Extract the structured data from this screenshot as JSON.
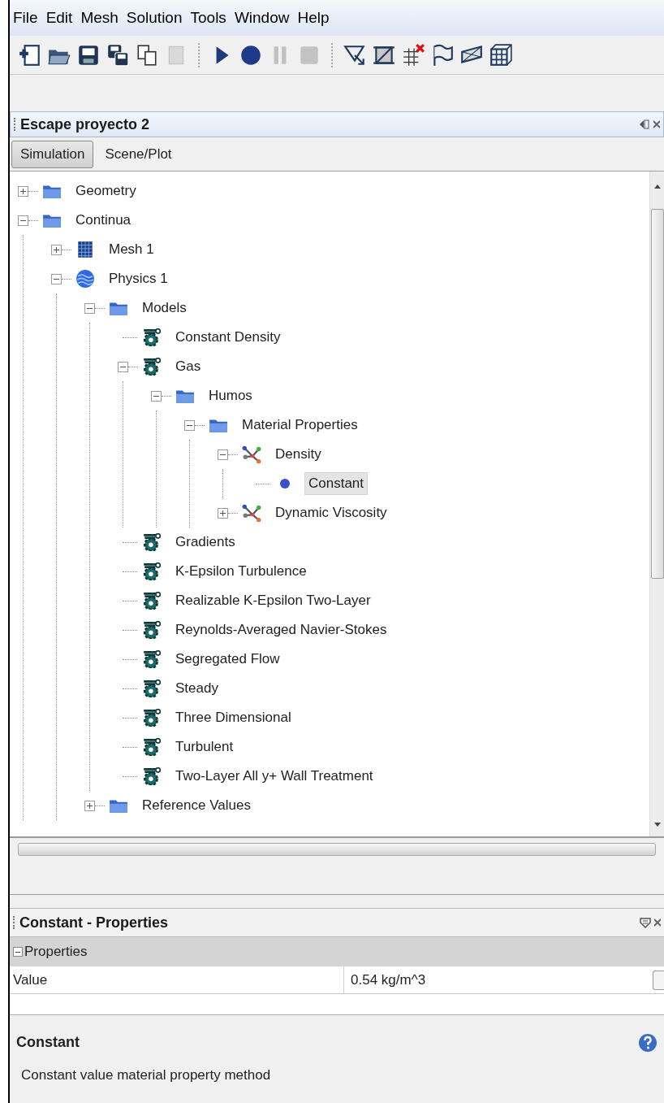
{
  "menu": [
    "File",
    "Edit",
    "Mesh",
    "Solution",
    "Tools",
    "Window",
    "Help"
  ],
  "toolbar": [
    {
      "kind": "new"
    },
    {
      "kind": "open"
    },
    {
      "kind": "save"
    },
    {
      "kind": "saveas"
    },
    {
      "kind": "copy"
    },
    {
      "kind": "blank",
      "disabled": true
    },
    {
      "kind": "sep"
    },
    {
      "kind": "play"
    },
    {
      "kind": "record"
    },
    {
      "kind": "pause",
      "disabled": true
    },
    {
      "kind": "stop",
      "disabled": true
    },
    {
      "kind": "sep"
    },
    {
      "kind": "select"
    },
    {
      "kind": "crop"
    },
    {
      "kind": "gridx"
    },
    {
      "kind": "flag"
    },
    {
      "kind": "plane"
    },
    {
      "kind": "cube"
    }
  ],
  "panel": {
    "title": "Escape proyecto 2"
  },
  "tabs": [
    {
      "label": "Simulation",
      "selected": true
    },
    {
      "label": "Scene/Plot",
      "selected": false
    }
  ],
  "tree": [
    {
      "label": "Geometry",
      "kind": "folder",
      "expanded": false,
      "selected": false
    },
    {
      "label": "Continua",
      "kind": "folder",
      "expanded": true,
      "selected": false,
      "children": [
        {
          "label": "Mesh 1",
          "kind": "mesh",
          "expanded": false,
          "selected": false
        },
        {
          "label": "Physics 1",
          "kind": "physics",
          "expanded": true,
          "selected": false,
          "children": [
            {
              "label": "Models",
              "kind": "folder",
              "expanded": true,
              "selected": false,
              "children": [
                {
                  "label": "Constant Density",
                  "kind": "model",
                  "selected": false
                },
                {
                  "label": "Gas",
                  "kind": "model",
                  "expanded": true,
                  "selected": false,
                  "children": [
                    {
                      "label": "Humos",
                      "kind": "folder",
                      "expanded": true,
                      "selected": false,
                      "children": [
                        {
                          "label": "Material Properties",
                          "kind": "folder",
                          "expanded": true,
                          "selected": false,
                          "children": [
                            {
                              "label": "Density",
                              "kind": "method",
                              "expanded": true,
                              "selected": false,
                              "children": [
                                {
                                  "label": "Constant",
                                  "kind": "value",
                                  "selected": true
                                }
                              ]
                            },
                            {
                              "label": "Dynamic Viscosity",
                              "kind": "method",
                              "expanded": false,
                              "selected": false
                            }
                          ]
                        }
                      ]
                    }
                  ]
                },
                {
                  "label": "Gradients",
                  "kind": "model",
                  "selected": false
                },
                {
                  "label": "K-Epsilon Turbulence",
                  "kind": "model",
                  "selected": false
                },
                {
                  "label": "Realizable K-Epsilon Two-Layer",
                  "kind": "model",
                  "selected": false
                },
                {
                  "label": "Reynolds-Averaged Navier-Stokes",
                  "kind": "model",
                  "selected": false
                },
                {
                  "label": "Segregated Flow",
                  "kind": "model",
                  "selected": false
                },
                {
                  "label": "Steady",
                  "kind": "model",
                  "selected": false
                },
                {
                  "label": "Three Dimensional",
                  "kind": "model",
                  "selected": false
                },
                {
                  "label": "Turbulent",
                  "kind": "model",
                  "selected": false
                },
                {
                  "label": "Two-Layer All y+ Wall Treatment",
                  "kind": "model",
                  "selected": false
                }
              ]
            },
            {
              "label": "Reference Values",
              "kind": "folder",
              "expanded": false,
              "selected": false
            }
          ]
        }
      ]
    }
  ],
  "properties": {
    "title": "Constant - Properties",
    "group": "Properties",
    "group_expanded": true,
    "rows": [
      {
        "name": "Value",
        "value": "0.54 kg/m^3"
      }
    ],
    "description_title": "Constant",
    "description": "Constant value material property method"
  }
}
